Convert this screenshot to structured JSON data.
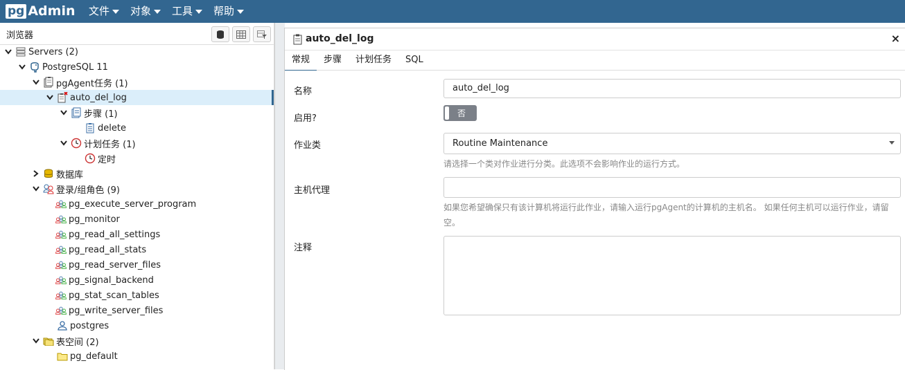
{
  "app": {
    "logo_pg": "pg",
    "logo_admin": "Admin"
  },
  "menu": [
    {
      "label": "文件"
    },
    {
      "label": "对象"
    },
    {
      "label": "工具"
    },
    {
      "label": "帮助"
    }
  ],
  "browser": {
    "title": "浏览器",
    "tree": [
      {
        "label": "Servers (2)",
        "icon": "servers-icon"
      },
      {
        "label": "PostgreSQL 11",
        "icon": "elephant-icon"
      },
      {
        "label": "pgAgent任务 (1)",
        "icon": "jobs-icon"
      },
      {
        "label": "auto_del_log",
        "icon": "job-icon"
      },
      {
        "label": "步骤 (1)",
        "icon": "steps-icon"
      },
      {
        "label": "delete",
        "icon": "step-icon"
      },
      {
        "label": "计划任务 (1)",
        "icon": "schedules-icon"
      },
      {
        "label": "定时",
        "icon": "clock-icon"
      },
      {
        "label": "数据库",
        "icon": "database-icon"
      },
      {
        "label": "登录/组角色 (9)",
        "icon": "roles-icon"
      },
      {
        "label": "pg_execute_server_program",
        "icon": "group-role-icon"
      },
      {
        "label": "pg_monitor",
        "icon": "group-role-icon"
      },
      {
        "label": "pg_read_all_settings",
        "icon": "group-role-icon"
      },
      {
        "label": "pg_read_all_stats",
        "icon": "group-role-icon"
      },
      {
        "label": "pg_read_server_files",
        "icon": "group-role-icon"
      },
      {
        "label": "pg_signal_backend",
        "icon": "group-role-icon"
      },
      {
        "label": "pg_stat_scan_tables",
        "icon": "group-role-icon"
      },
      {
        "label": "pg_write_server_files",
        "icon": "group-role-icon"
      },
      {
        "label": "postgres",
        "icon": "user-icon"
      },
      {
        "label": "表空间 (2)",
        "icon": "tablespaces-icon"
      },
      {
        "label": "pg_default",
        "icon": "folder-icon"
      }
    ]
  },
  "dialog": {
    "title": "auto_del_log",
    "close": "×",
    "tabs": [
      {
        "label": "常规"
      },
      {
        "label": "步骤"
      },
      {
        "label": "计划任务"
      },
      {
        "label": "SQL"
      }
    ],
    "active_tab": "常规",
    "fields": {
      "name_label": "名称",
      "name_value": "auto_del_log",
      "enabled_label": "启用?",
      "enabled_value": "否",
      "jobclass_label": "作业类",
      "jobclass_value": "Routine Maintenance",
      "jobclass_help": "请选择一个类对作业进行分类。此选项不会影响作业的运行方式。",
      "hostagent_label": "主机代理",
      "hostagent_value": "",
      "hostagent_help": "如果您希望确保只有该计算机将运行此作业，请输入运行pgAgent的计算机的主机名。 如果任何主机可以运行作业，请留空。",
      "comment_label": "注释",
      "comment_value": ""
    }
  },
  "colors": {
    "topbar": "#326690",
    "selection": "#dbeefa"
  }
}
